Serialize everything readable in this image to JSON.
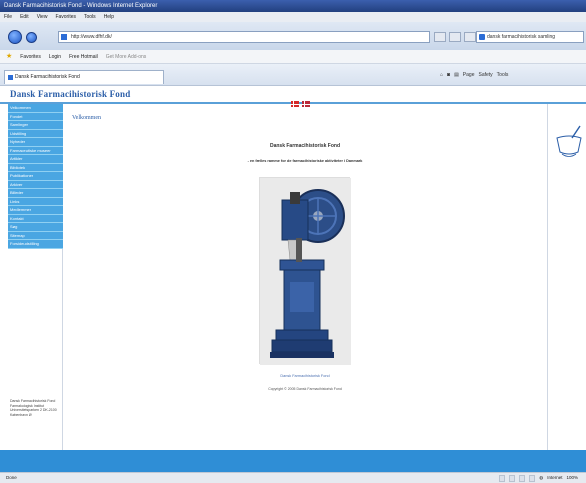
{
  "window": {
    "title": "Dansk Farmacihistorisk Fond - Windows Internet Explorer"
  },
  "menu": [
    "File",
    "Edit",
    "View",
    "Favorites",
    "Tools",
    "Help"
  ],
  "address": {
    "url": "http://www.dfhf.dk/"
  },
  "search": {
    "text": "dansk farmacihistorisk samling"
  },
  "favorites": {
    "label": "Favorites",
    "items": [
      "Login",
      "Free Hotmail",
      "Get More Add-ons"
    ]
  },
  "tab": {
    "label": "Dansk Farmacihistorisk Fond"
  },
  "command_bar": [
    "Page",
    "Safety",
    "Tools"
  ],
  "site": {
    "title": "Dansk Farmacihistorisk Fond",
    "sidebar_items": [
      "Velkommen",
      "Fondet",
      "Samlinger",
      "Udstilling",
      "Nyheder",
      "Farmaceutiske museer",
      "Artikler",
      "Bibliotek",
      "Publikationer",
      "Arkiver",
      "Billeder",
      "Links",
      "Medlemmer",
      "Kontakt",
      "Søg",
      "Sitemap",
      "Forsideudstilling"
    ],
    "sidebar_footer": "Dansk Farmacihistorisk Fond Farmakologisk Institut Universitetsparken 2 DK-2100 København Ø",
    "welcome": "Velkommen",
    "heading": "Dansk Farmacihistorisk Fond",
    "subheading": "- en fælles ramme for de farmacihistoriske aktiviteter i Danmark",
    "caption": "Dansk Farmacihistorisk Fond",
    "copyright": "Copyright © 2005 Dansk Farmacihistorisk Fond"
  },
  "status": {
    "left": "Done",
    "zone": "Internet",
    "zoom": "100%"
  },
  "colors": {
    "accent": "#4aa6e2",
    "title": "#2b5ea8",
    "stripe": "#2f8ed6"
  }
}
